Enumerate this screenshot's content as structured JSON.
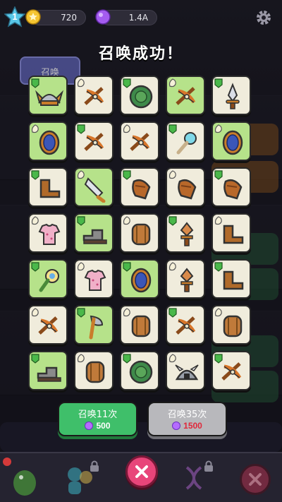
{
  "topbar": {
    "level": "1",
    "gold": "720",
    "gems": "1.4A"
  },
  "title": "召唤成功！",
  "tab": "召唤",
  "colors": {
    "green_bg": "#b6e28a",
    "white_bg": "#f0ecdc",
    "accent_pink": "#e8457a"
  },
  "grid": [
    [
      "helmet-horn",
      "crossbow",
      "turtle-shell",
      "crossbow",
      "dagger"
    ],
    [
      "round-shield",
      "crossbow",
      "crossbow",
      "magic-wand",
      "round-shield"
    ],
    [
      "boot",
      "cleaver",
      "glove",
      "glove",
      "glove"
    ],
    [
      "shirt",
      "boot-grey",
      "wood-shield",
      "sword-hilt",
      "boot"
    ],
    [
      "flower-wand",
      "shirt",
      "round-shield",
      "sword-hilt",
      "boot"
    ],
    [
      "crossbow",
      "axe",
      "wood-shield",
      "crossbow",
      "wood-shield"
    ],
    [
      "boot-grey",
      "wood-shield",
      "turtle-shell",
      "helmet-spiked",
      "crossbow"
    ]
  ],
  "grid_bg": [
    [
      "green",
      "white",
      "white",
      "green",
      "white"
    ],
    [
      "green",
      "white",
      "white",
      "white",
      "green"
    ],
    [
      "white",
      "green",
      "white",
      "white",
      "white"
    ],
    [
      "white",
      "green",
      "white",
      "white",
      "white"
    ],
    [
      "green",
      "white",
      "green",
      "white",
      "white"
    ],
    [
      "white",
      "green",
      "white",
      "white",
      "white"
    ],
    [
      "green",
      "white",
      "white",
      "white",
      "white"
    ]
  ],
  "buttons": {
    "summon11": {
      "label": "召唤11次",
      "cost": "500"
    },
    "summon35": {
      "label": "召唤35次",
      "cost": "1500"
    }
  }
}
